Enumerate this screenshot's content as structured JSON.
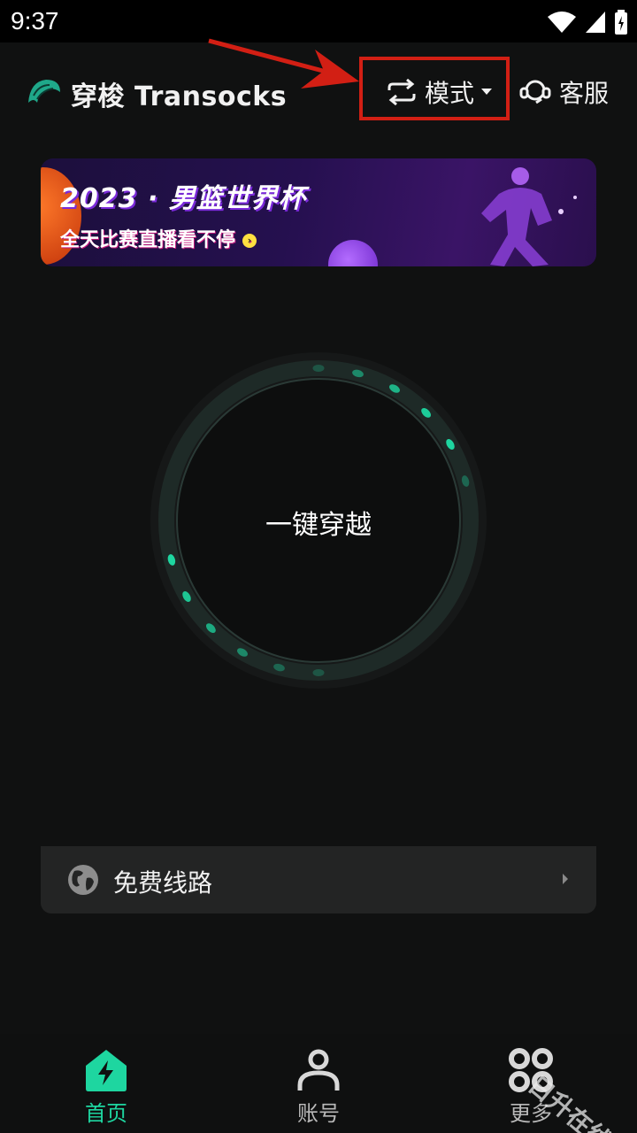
{
  "status_bar": {
    "time": "9:37"
  },
  "header": {
    "brand": "穿梭 Transocks",
    "mode_label": "模式",
    "support_label": "客服"
  },
  "banner": {
    "title": "2023 · 男篮世界杯",
    "subtitle": "全天比赛直播看不停"
  },
  "connect": {
    "label": "一键穿越"
  },
  "route": {
    "label": "免费线路"
  },
  "bottom_nav": {
    "items": [
      {
        "label": "首页",
        "icon": "home-bolt-icon",
        "active": true
      },
      {
        "label": "账号",
        "icon": "person-icon",
        "active": false
      },
      {
        "label": "更多",
        "icon": "grid-dots-icon",
        "active": false
      }
    ]
  },
  "watermark": "日升在线",
  "colors": {
    "accent": "#1ed6a0",
    "background": "#101111",
    "annotation_red": "#d21f14",
    "panel": "#232424"
  }
}
